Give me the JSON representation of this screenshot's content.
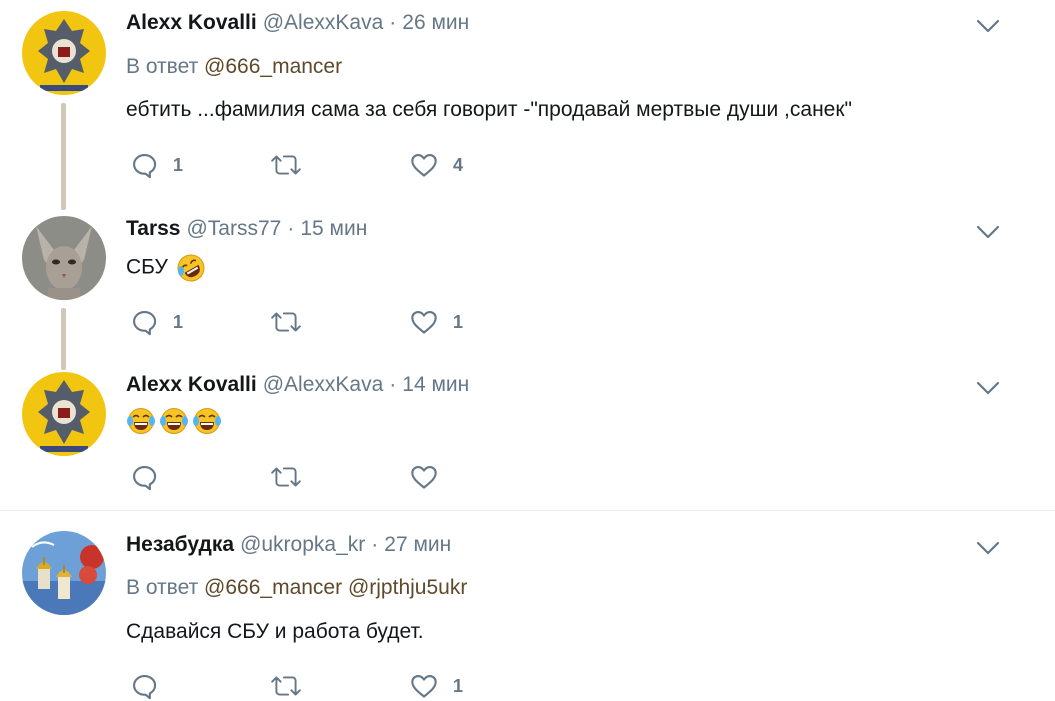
{
  "tweets": [
    {
      "name": "Alexx Kovalli",
      "handle": "@AlexxKava",
      "time": "26 мин",
      "reply_prefix": "В ответ",
      "reply_to": "@666_mancer",
      "reply_to_2": "",
      "text": "ебтить ...фамилия сама за себя говорит -\"продавай мертвые души ,санек\"",
      "reply_count": "1",
      "retweet_count": "",
      "like_count": "4",
      "avatar": "yellow-emblem-avatar"
    },
    {
      "name": "Tarss",
      "handle": "@Tarss77",
      "time": "15 мин",
      "text": "СБУ",
      "emoji": "rolling-on-floor-laughing-emoji",
      "reply_count": "1",
      "retweet_count": "",
      "like_count": "1",
      "avatar": "sphynx-cat-avatar"
    },
    {
      "name": "Alexx Kovalli",
      "handle": "@AlexxKava",
      "time": "14 мин",
      "emoji": "tears-of-joy-emoji x3",
      "reply_count": "",
      "retweet_count": "",
      "like_count": "",
      "avatar": "yellow-emblem-avatar"
    },
    {
      "name": "Незабудка",
      "handle": "@ukropka_kr",
      "time": "27 мин",
      "reply_prefix": "В ответ",
      "reply_to": "@666_mancer",
      "reply_to_2": "@rjpthju5ukr",
      "text": "Сдавайся СБУ и работа будет.",
      "reply_count": "",
      "retweet_count": "",
      "like_count": "1",
      "avatar": "church-domes-avatar"
    }
  ],
  "separator": "·",
  "colors": {
    "name": "#14171a",
    "meta": "#657786",
    "mention": "#5e4a2a",
    "thread_line": "#cfc8b8",
    "divider": "#e6ecf0"
  }
}
